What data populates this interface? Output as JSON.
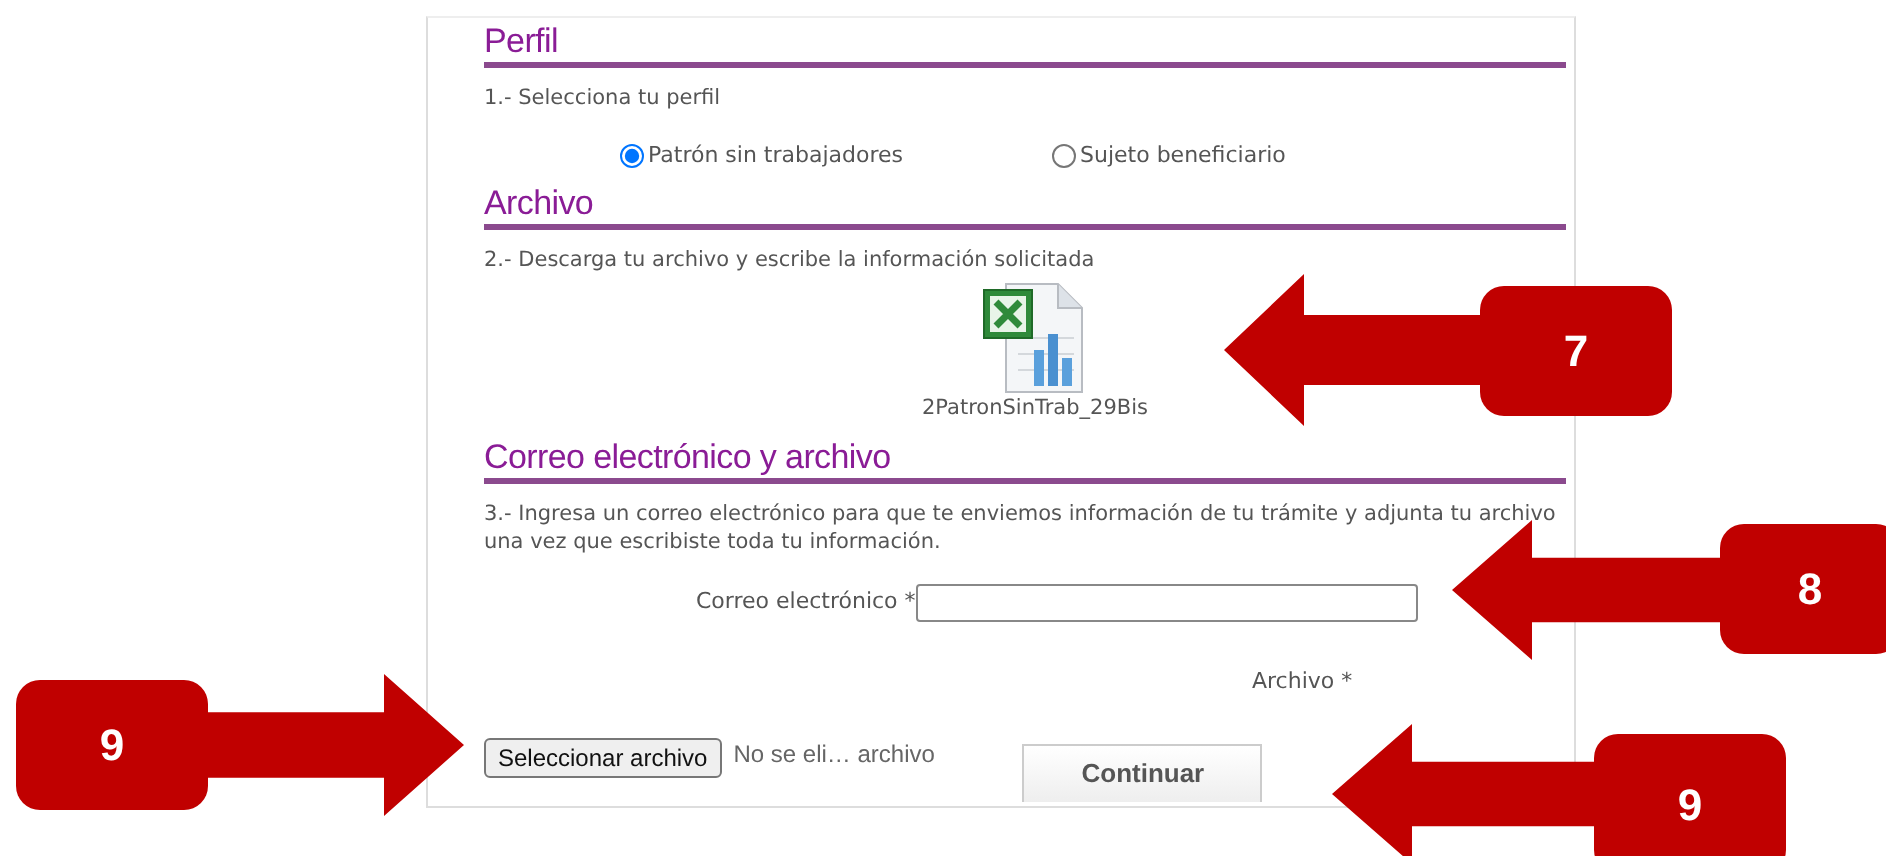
{
  "profile": {
    "heading": "Perfil",
    "instruction": "1.- Selecciona tu perfil",
    "options": [
      {
        "label": "Patrón sin trabajadores",
        "selected": true
      },
      {
        "label": "Sujeto beneficiario",
        "selected": false
      }
    ]
  },
  "file_section": {
    "heading": "Archivo",
    "instruction": "2.- Descarga tu archivo y escribe la información solicitada",
    "download_name": "2PatronSinTrab_29Bis"
  },
  "email_section": {
    "heading": "Correo electrónico y archivo",
    "instruction": "3.- Ingresa un correo electrónico para que te enviemos información de tu trámite y adjunta tu archivo una vez que escribiste toda tu información.",
    "email_label": "Correo electrónico *",
    "file_label": "Archivo *",
    "file_button": "Seleccionar archivo",
    "file_status": "No se eli… archivo",
    "submit": "Continuar"
  },
  "callouts": [
    {
      "number": "7"
    },
    {
      "number": "8"
    },
    {
      "number": "9"
    },
    {
      "number": "9"
    }
  ]
}
